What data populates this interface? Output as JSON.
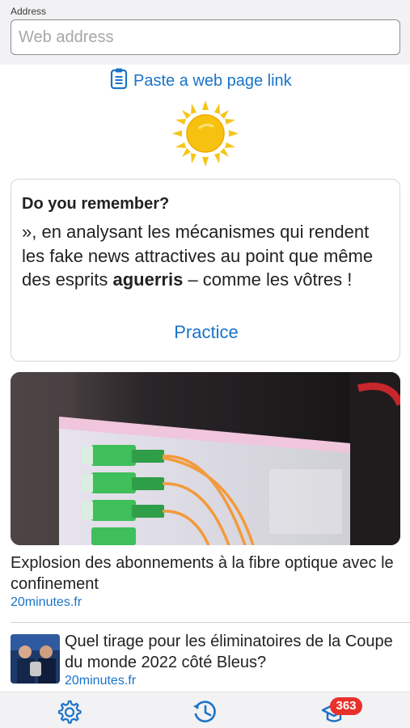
{
  "address_bar": {
    "label": "Address",
    "placeholder": "Web address",
    "value": ""
  },
  "paste_link": {
    "label": "Paste a web page link",
    "icon": "clipboard-icon"
  },
  "weather_icon": "sun-icon",
  "remember_card": {
    "title": "Do you remember?",
    "text_before": "», en analysant les mécanismes qui rendent les fake news attractives au point que même des esprits ",
    "text_bold": "aguerris",
    "text_after": " – comme les vôtres !",
    "practice_label": "Practice"
  },
  "articles": [
    {
      "title": "Explosion des abonnements à la fibre optique avec le confinement",
      "source": "20minutes.fr"
    },
    {
      "title": "Quel tirage pour les éliminatoires de la Coupe du monde 2022 côté Bleus?",
      "source": "20minutes.fr"
    }
  ],
  "tab_bar": {
    "settings_icon": "gear-icon",
    "history_icon": "history-clock-icon",
    "learn_icon": "graduation-cap-icon",
    "badge_count": "363"
  },
  "colors": {
    "accent": "#1a73c8",
    "badge": "#e8312b",
    "sun": "#f5c518"
  }
}
